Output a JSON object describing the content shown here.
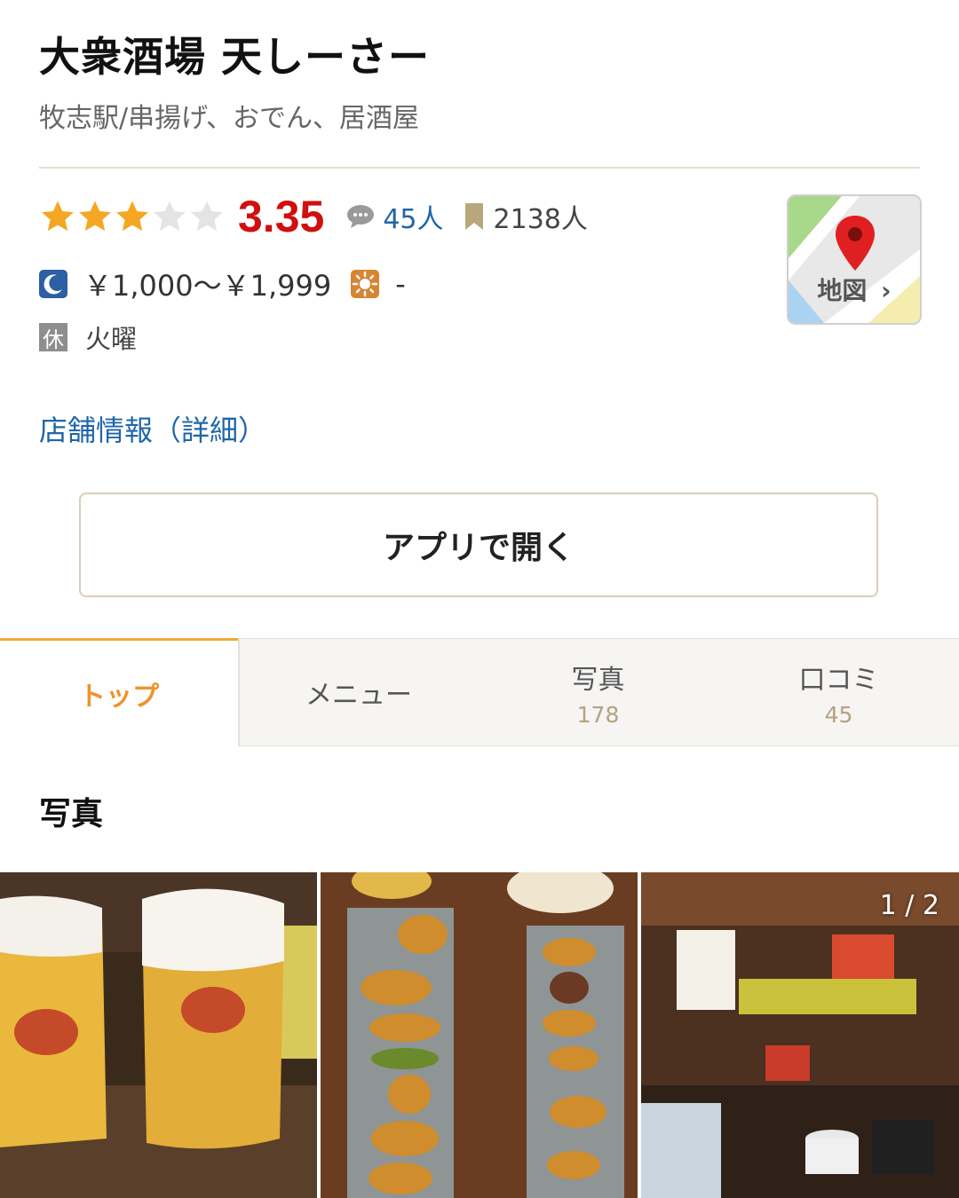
{
  "restaurant": {
    "name": "大衆酒場 天しーさー",
    "subtitle": "牧志駅/串揚げ、おでん、居酒屋"
  },
  "rating": {
    "stars_filled": 3,
    "stars_total": 5,
    "score": "3.35",
    "review_count": "45人",
    "save_count": "2138人",
    "star_color": "#f5a623",
    "score_color": "#d0100f"
  },
  "price": {
    "dinner": "￥1,000～￥1,999",
    "lunch": "-"
  },
  "holiday": {
    "badge": "休",
    "value": "火曜"
  },
  "map": {
    "label": "地図",
    "chevron": "›"
  },
  "detail_link": "店舗情報（詳細）",
  "open_app_button": "アプリで開く",
  "tabs": [
    {
      "label": "トップ",
      "count": "",
      "active": true
    },
    {
      "label": "メニュー",
      "count": "",
      "active": false
    },
    {
      "label": "写真",
      "count": "178",
      "active": false
    },
    {
      "label": "口コミ",
      "count": "45",
      "active": false
    }
  ],
  "photos_section": {
    "title": "写真",
    "counter": "1 / 2",
    "items": [
      "beer-mugs-photo",
      "kushiage-skewers-photo",
      "izakaya-counter-photo"
    ]
  },
  "icons": {
    "review": "speech-bubble-icon",
    "save": "bookmark-icon",
    "dinner": "moon-icon",
    "lunch": "sun-icon",
    "map_pin": "map-pin-icon"
  }
}
